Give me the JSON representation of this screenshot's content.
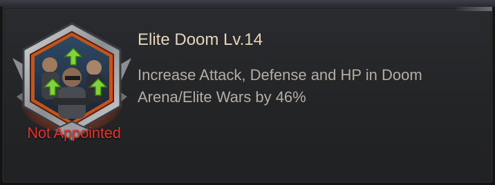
{
  "card": {
    "title": "Elite Doom Lv.14",
    "description_line1": "Increase Attack, Defense and HP in Doom",
    "description_line2": "Arena/Elite Wars by 46%",
    "status": "Not Appointed",
    "badge_icon": "elite-doom-officer-badge-icon",
    "status_color": "#e8322a",
    "title_color": "#e5d6ba"
  }
}
